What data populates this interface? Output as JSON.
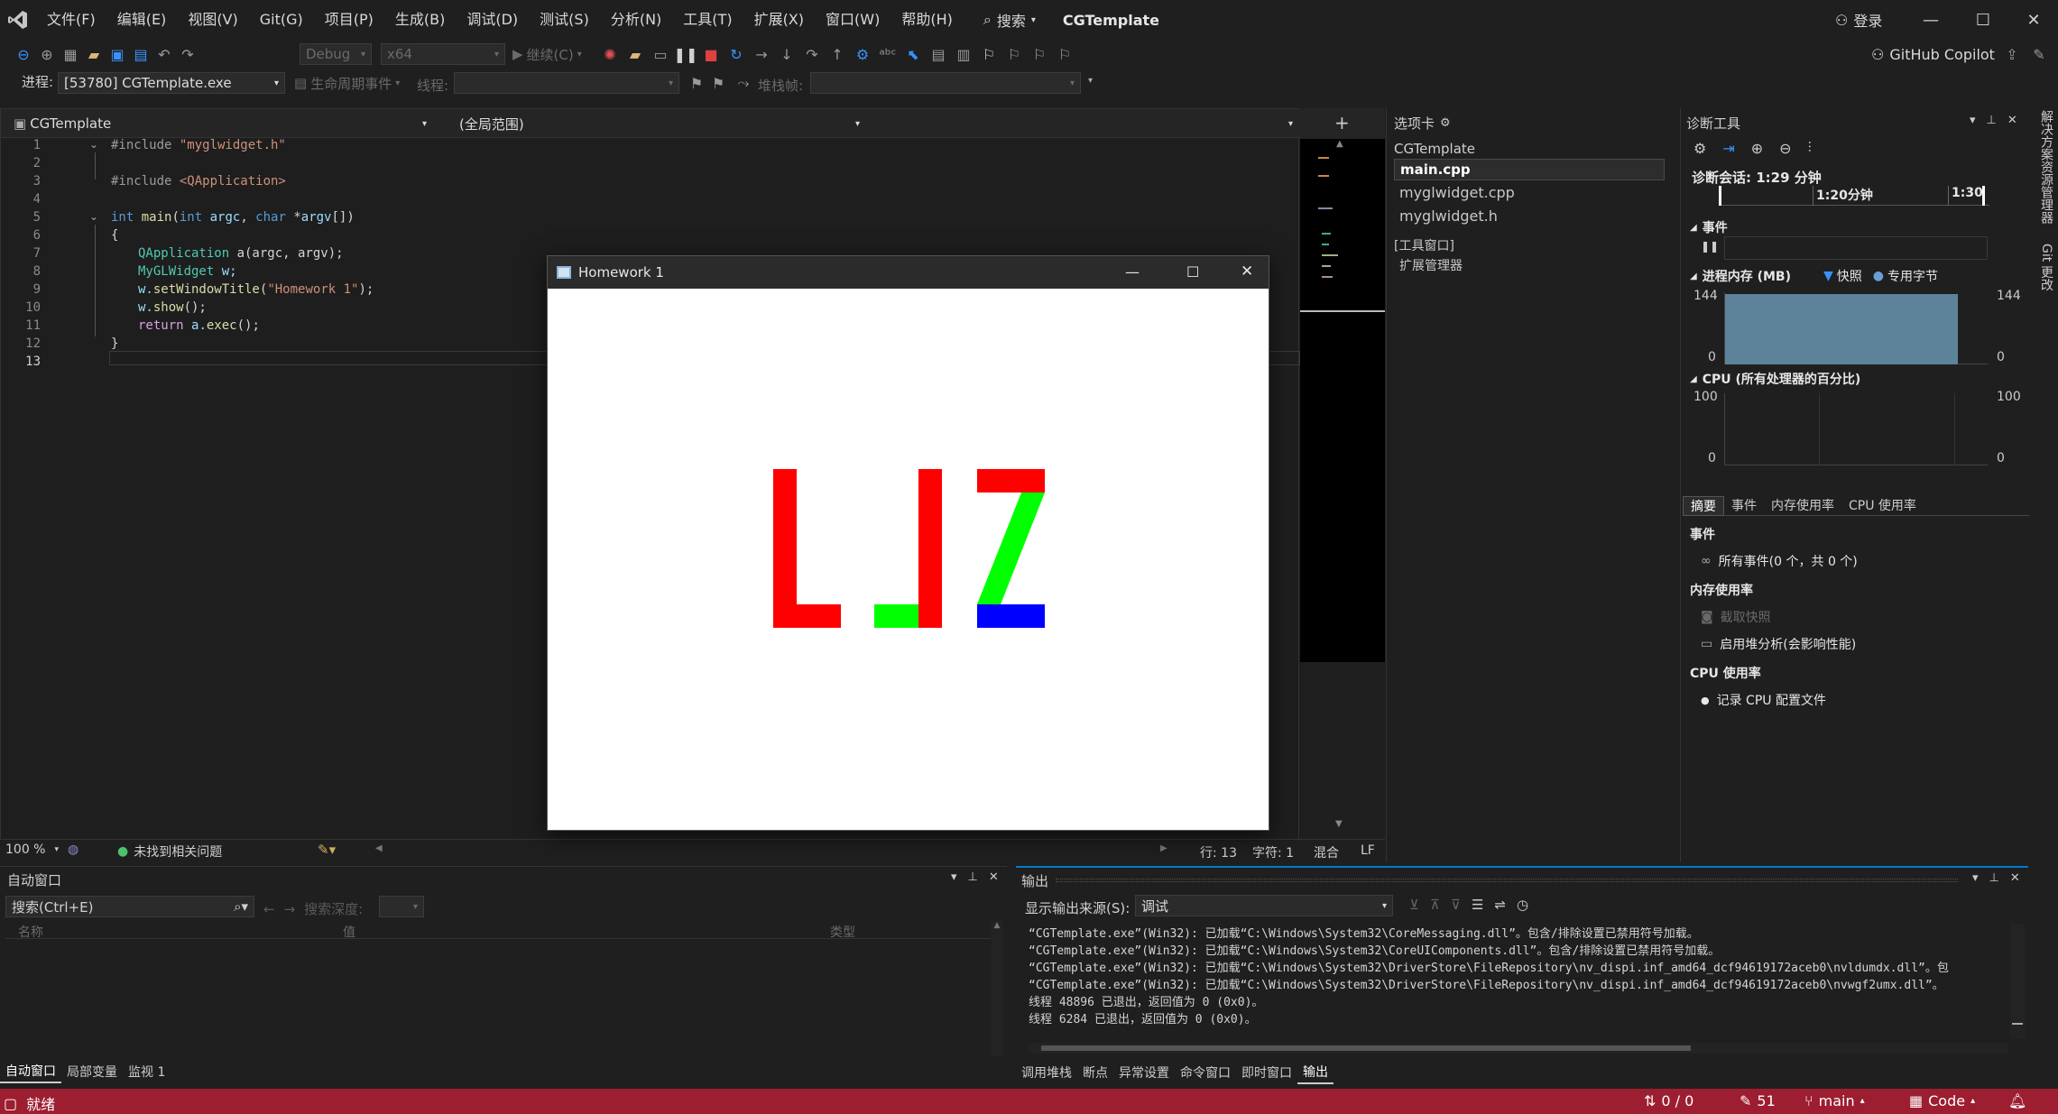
{
  "menu": [
    "文件(F)",
    "编辑(E)",
    "视图(V)",
    "Git(G)",
    "项目(P)",
    "生成(B)",
    "调试(D)",
    "测试(S)",
    "分析(N)",
    "工具(T)",
    "扩展(X)",
    "窗口(W)",
    "帮助(H)"
  ],
  "search_label": "搜索",
  "solution_title": "CGTemplate",
  "signin_label": "登录",
  "copilot_label": "GitHub Copilot",
  "toolbar": {
    "config": "Debug",
    "platform": "x64",
    "continue": "继续(C)"
  },
  "toolbar2": {
    "process_label": "进程:",
    "process_value": "[53780] CGTemplate.exe",
    "lifecycle_label": "生命周期事件",
    "thread_label": "线程:",
    "stackframe_label": "堆栈帧:"
  },
  "editor": {
    "project_combo": "CGTemplate",
    "scope_combo": "(全局范围)",
    "line_numbers": [
      "1",
      "2",
      "3",
      "4",
      "5",
      "6",
      "7",
      "8",
      "9",
      "10",
      "11",
      "12",
      "13"
    ]
  },
  "code": {
    "l1_dir": "#include ",
    "l1_str": "\"myglwidget.h\"",
    "l3_dir": "#include ",
    "l3_str": "<QApplication>",
    "l5_int": "int ",
    "l5_main": "main",
    "l5_p1": "(",
    "l5_int2": "int ",
    "l5_argc": "argc",
    "l5_p2": ", ",
    "l5_char": "char ",
    "l5_p3": "*",
    "l5_argv": "argv",
    "l5_p4": "[])",
    "l6": "{",
    "l7_ty": "QApplication ",
    "l7_rest": "a(argc, argv);",
    "l8_ty": "MyGLWidget ",
    "l8_rest": "w;",
    "l9_a": "w.",
    "l9_fn": "setWindowTitle",
    "l9_p": "(",
    "l9_str": "\"Homework 1\"",
    "l9_e": ");",
    "l10_a": "w.",
    "l10_fn": "show",
    "l10_e": "();",
    "l11_kw": "return ",
    "l11_a": "a.",
    "l11_fn": "exec",
    "l11_e": "();",
    "l12": "}"
  },
  "editor_status": {
    "zoom": "100 %",
    "issues": "未找到相关问题",
    "line": "行: 13",
    "col": "字符: 1",
    "mixed": "混合",
    "eol": "LF"
  },
  "tabs_panel": {
    "title": "选项卡",
    "group": "CGTemplate",
    "files": [
      "main.cpp",
      "myglwidget.cpp",
      "myglwidget.h"
    ],
    "tool_group": "[工具窗口]",
    "tool_items": [
      "扩展管理器"
    ]
  },
  "diag": {
    "title": "诊断工具",
    "session": "诊断会话: 1:29 分钟",
    "timeline_1": "1:20分钟",
    "timeline_2": "1:30",
    "events_label": "事件",
    "mem_label": "进程内存 (MB)",
    "snapshot_label": "快照",
    "private_label": "专用字节",
    "mem_max": "144",
    "mem_min": "0",
    "cpu_label": "CPU (所有处理器的百分比)",
    "cpu_max": "100",
    "cpu_min": "0",
    "tabs": [
      "摘要",
      "事件",
      "内存使用率",
      "CPU 使用率"
    ],
    "sec_events": "事件",
    "all_events": "所有事件(0 个，共 0 个)",
    "sec_memory": "内存使用率",
    "take_snapshot": "截取快照",
    "heap_profile": "启用堆分析(会影响性能)",
    "sec_cpu": "CPU 使用率",
    "record_cpu": "记录 CPU 配置文件"
  },
  "side_strip": [
    "解决方案资源管理器",
    "Git 更改"
  ],
  "auto_window": {
    "title": "自动窗口",
    "search_placeholder": "搜索(Ctrl+E)",
    "depth_label": "搜索深度:",
    "cols": [
      "名称",
      "值",
      "类型"
    ],
    "tabs": [
      "自动窗口",
      "局部变量",
      "监视 1"
    ]
  },
  "output": {
    "title": "输出",
    "source_label": "显示输出来源(S):",
    "source_value": "调试",
    "lines": [
      "“CGTemplate.exe”(Win32): 已加载“C:\\Windows\\System32\\CoreMessaging.dll”。包含/排除设置已禁用符号加载。",
      "“CGTemplate.exe”(Win32): 已加载“C:\\Windows\\System32\\CoreUIComponents.dll”。包含/排除设置已禁用符号加载。",
      "“CGTemplate.exe”(Win32): 已加载“C:\\Windows\\System32\\DriverStore\\FileRepository\\nv_dispi.inf_amd64_dcf94619172aceb0\\nvldumdx.dll”。包",
      "“CGTemplate.exe”(Win32): 已加载“C:\\Windows\\System32\\DriverStore\\FileRepository\\nv_dispi.inf_amd64_dcf94619172aceb0\\nvwgf2umx.dll”。",
      "线程 48896 已退出，返回值为 0 (0x0)。",
      "线程 6284 已退出，返回值为 0 (0x0)。"
    ],
    "tabs": [
      "调用堆栈",
      "断点",
      "异常设置",
      "命令窗口",
      "即时窗口",
      "输出"
    ]
  },
  "statusbar": {
    "ready": "就绪",
    "sync": "0 / 0",
    "edits": "51",
    "branch": "main",
    "code": "Code"
  },
  "homework": {
    "title": "Homework 1"
  },
  "colors": {
    "red": "#ff0000",
    "green": "#00ff00",
    "blue": "#0000ff",
    "status_bg": "#9d1d31",
    "accent": "#007acc"
  }
}
